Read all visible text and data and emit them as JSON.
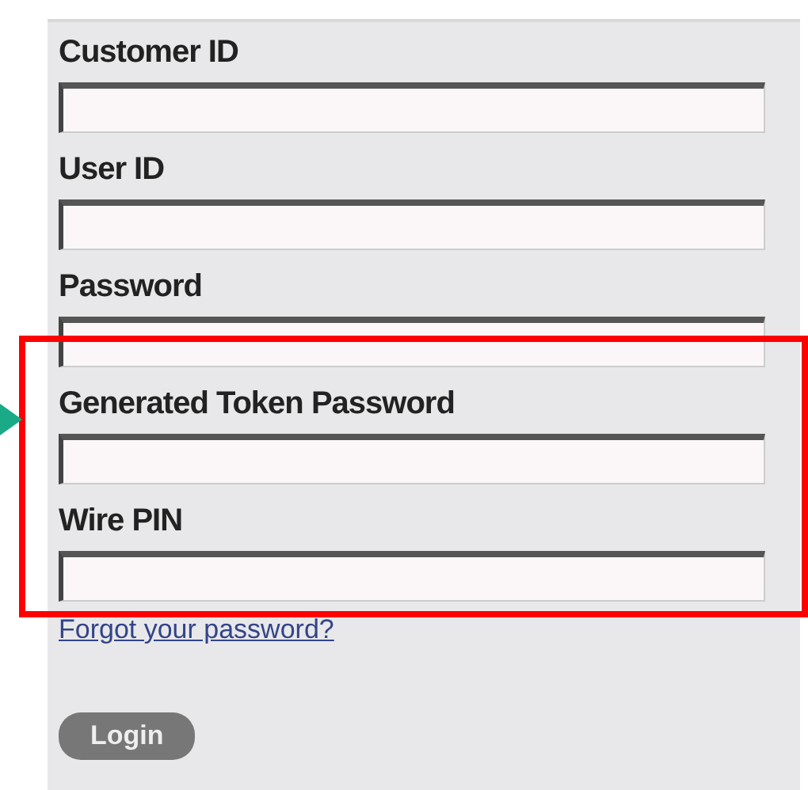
{
  "fields": [
    {
      "label": "Customer ID"
    },
    {
      "label": "User ID"
    },
    {
      "label": "Password"
    },
    {
      "label": "Generated Token Password"
    },
    {
      "label": "Wire PIN"
    }
  ],
  "forgot_link": "Forgot your password?",
  "login_button": "Login",
  "annotations": [
    {
      "kind": "box",
      "color": "#ff0000"
    },
    {
      "kind": "arrow",
      "color": "#1aaa88"
    }
  ]
}
